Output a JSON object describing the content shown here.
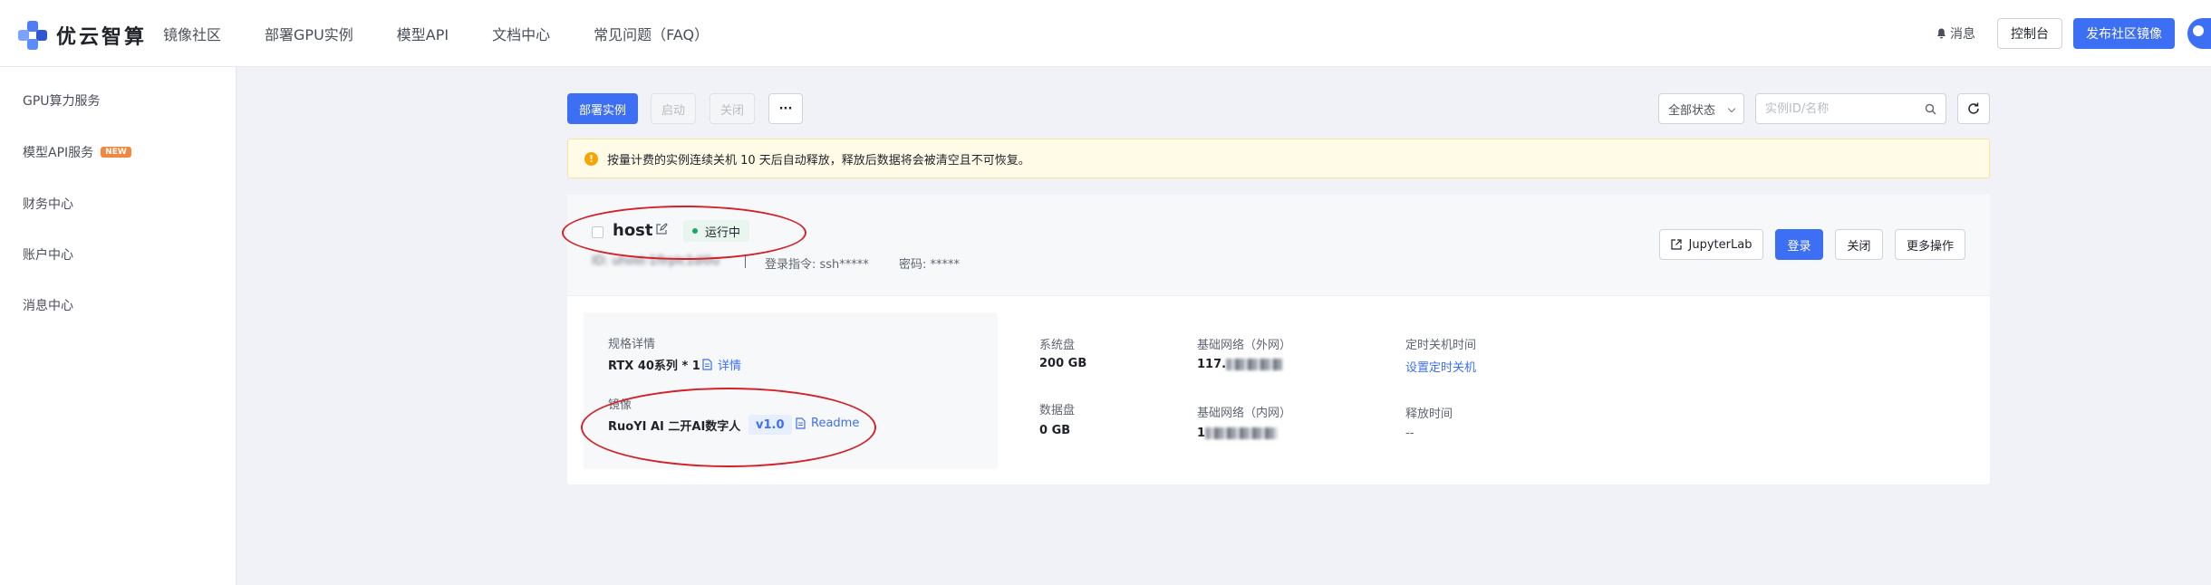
{
  "brand": {
    "name": "优云智算"
  },
  "nav": {
    "items": [
      "镜像社区",
      "部署GPU实例",
      "模型API",
      "文档中心",
      "常见问题（FAQ）"
    ]
  },
  "header": {
    "messages": "消息",
    "console": "控制台",
    "publish": "发布社区镜像"
  },
  "sidebar": {
    "items": [
      {
        "label": "GPU算力服务"
      },
      {
        "label": "模型API服务",
        "badge": "NEW"
      },
      {
        "label": "财务中心"
      },
      {
        "label": "账户中心"
      },
      {
        "label": "消息中心"
      }
    ]
  },
  "toolbar": {
    "deploy": "部署实例",
    "start": "启动",
    "stop": "关闭",
    "more": "···",
    "status_select": "全部状态",
    "search_placeholder": "实例ID/名称"
  },
  "notice": {
    "text": "按量计费的实例连续关机 10 天后自动释放，释放后数据将会被清空且不可恢复。"
  },
  "instance": {
    "name": "host",
    "status": "运行中",
    "id": "ID: uhost-1flrplc1dl0u",
    "login_cmd": "登录指令: ssh*****",
    "password": "密码: *****",
    "actions": {
      "jupyter": "JupyterLab",
      "login": "登录",
      "close": "关闭",
      "more": "更多操作"
    },
    "spec": {
      "spec_label": "规格详情",
      "spec_value": "RTX 40系列 * 1",
      "details_link": "详情",
      "image_label": "镜像",
      "image_value": "RuoYI AI 二开AI数字人",
      "version": "v1.0",
      "readme": "Readme"
    },
    "disk": {
      "system_label": "系统盘",
      "system_value": "200 GB",
      "data_label": "数据盘",
      "data_value": "0 GB"
    },
    "network": {
      "public_label": "基础网络（外网）",
      "public_value": "117.",
      "private_label": "基础网络（内网）",
      "private_value": "1"
    },
    "schedule": {
      "shutdown_label": "定时关机时间",
      "shutdown_link": "设置定时关机",
      "release_label": "释放时间",
      "release_value": "--"
    }
  }
}
